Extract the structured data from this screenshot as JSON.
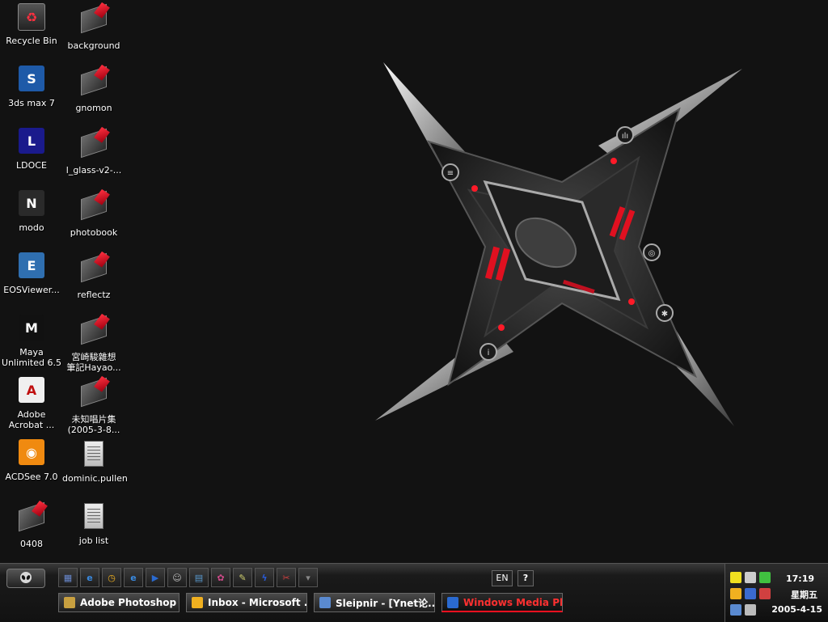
{
  "desktop": {
    "icons": [
      {
        "label": "Recycle Bin",
        "kind": "recycle"
      },
      {
        "label": "background",
        "kind": "folder"
      },
      {
        "label": "3ds max 7",
        "kind": "app",
        "color": "#1e5aa8",
        "glyph": "S"
      },
      {
        "label": "gnomon",
        "kind": "folder"
      },
      {
        "label": "LDOCE",
        "kind": "app",
        "color": "#1a1a8c",
        "glyph": "L"
      },
      {
        "label": "l_glass-v2-...",
        "kind": "folder"
      },
      {
        "label": "modo",
        "kind": "app",
        "color": "#2a2a2a",
        "glyph": "N"
      },
      {
        "label": "photobook",
        "kind": "folder"
      },
      {
        "label": "EOSViewer...",
        "kind": "app",
        "color": "#2f6fb0",
        "glyph": "E"
      },
      {
        "label": "reflectz",
        "kind": "folder"
      },
      {
        "label": "Maya\nUnlimited 6.5",
        "kind": "app",
        "color": "#111111",
        "glyph": "M"
      },
      {
        "label": "宮崎駿雜想\n筆記Hayao...",
        "kind": "folder"
      },
      {
        "label": "Adobe\nAcrobat ...",
        "kind": "app",
        "color": "#f0f0f0",
        "glyph": "A"
      },
      {
        "label": "未知唱片集\n(2005-3-8...",
        "kind": "folder"
      },
      {
        "label": "ACDSee 7.0",
        "kind": "app",
        "color": "#f08a10",
        "glyph": "◉"
      },
      {
        "label": "dominic.pullen",
        "kind": "doc"
      },
      {
        "label": "0408",
        "kind": "folder"
      },
      {
        "label": "job list",
        "kind": "doc"
      }
    ]
  },
  "taskbar": {
    "quick_launch": [
      {
        "name": "show-desktop-icon",
        "color": "#6a8ad0",
        "glyph": "▦"
      },
      {
        "name": "ie-icon",
        "color": "#3a8ae0",
        "glyph": "e"
      },
      {
        "name": "outlook-icon",
        "color": "#f0b020",
        "glyph": "◷"
      },
      {
        "name": "browser-icon",
        "color": "#3a8ae0",
        "glyph": "e"
      },
      {
        "name": "media-player-icon",
        "color": "#2a6ad0",
        "glyph": "▶"
      },
      {
        "name": "alien-icon",
        "color": "#bbbbbb",
        "glyph": "☺"
      },
      {
        "name": "network-icon",
        "color": "#5a9ad0",
        "glyph": "▤"
      },
      {
        "name": "flower-icon",
        "color": "#d04a8a",
        "glyph": "✿"
      },
      {
        "name": "notepad-icon",
        "color": "#d0d070",
        "glyph": "✎"
      },
      {
        "name": "flash-icon",
        "color": "#2a5ad0",
        "glyph": "ϟ"
      },
      {
        "name": "tools-icon",
        "color": "#d04040",
        "glyph": "✂"
      },
      {
        "name": "chevron-down-icon",
        "color": "#888888",
        "glyph": "▾"
      }
    ],
    "tasks": [
      {
        "label": "Adobe Photoshop",
        "color": "#c8a040",
        "active": false
      },
      {
        "label": "Inbox - Microsoft ...",
        "color": "#f0b020",
        "active": false
      },
      {
        "label": "Sleipnir - [Ynet论...",
        "color": "#5a8ad0",
        "active": false
      },
      {
        "label": "Windows Media Pl...",
        "color": "#2a6ad0",
        "active": true
      }
    ],
    "language": "EN",
    "help": "?",
    "tray_colors": [
      "#f0e020",
      "#cccccc",
      "#40c040",
      "#f0b020",
      "#3a6ad0",
      "#d04040",
      "#5a8ad0",
      "#bbbbbb"
    ],
    "clock": {
      "time": "17:19",
      "day": "星期五",
      "date": "2005-4-15"
    }
  },
  "colors": {
    "accent": "#ff1a28",
    "background": "#121212"
  }
}
